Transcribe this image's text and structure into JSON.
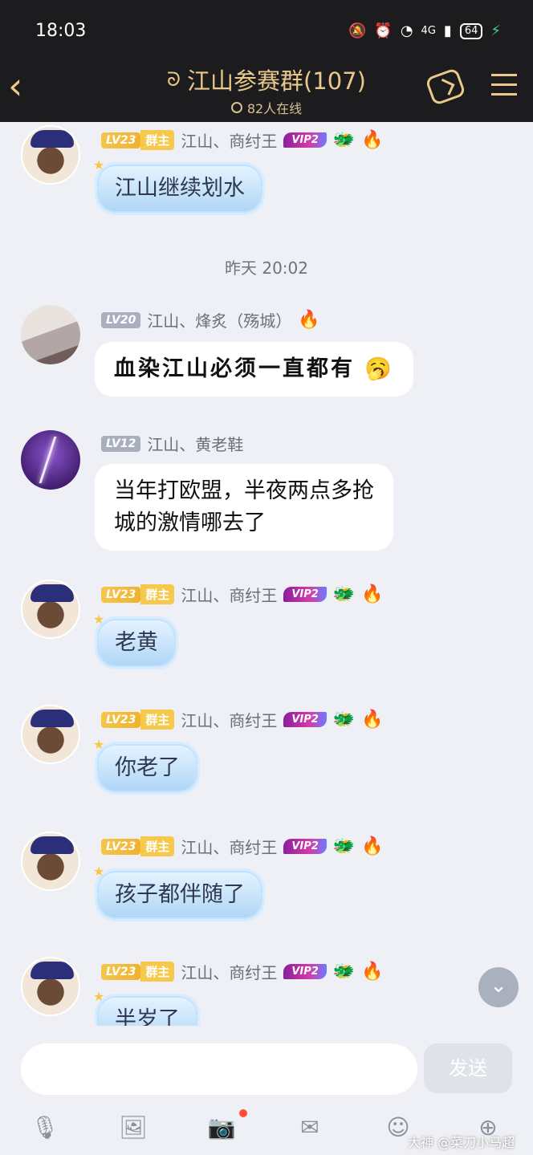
{
  "status_bar": {
    "time": "18:03",
    "network": "4G",
    "battery": "64"
  },
  "header": {
    "title": "江山参赛群(107)",
    "online": "82人在线",
    "icons": [
      "back-icon",
      "ear-icon",
      "share-link-icon",
      "menu-icon"
    ]
  },
  "messages": [
    {
      "level": "LV23",
      "role": "群主",
      "name": "江山、商纣王",
      "vip": "VIP2",
      "text": "江山继续划水"
    },
    {
      "timestamp": "昨天 20:02"
    },
    {
      "level": "LV20",
      "name": "江山、烽炙（殇城）",
      "text": "血染江山必须一直都有"
    },
    {
      "level": "LV12",
      "name": "江山、黄老鞋",
      "text_line1": "当年打欧盟，半夜两点多抢",
      "text_line2": "城的激情哪去了"
    },
    {
      "level": "LV23",
      "role": "群主",
      "name": "江山、商纣王",
      "vip": "VIP2",
      "text": "老黄"
    },
    {
      "level": "LV23",
      "role": "群主",
      "name": "江山、商纣王",
      "vip": "VIP2",
      "text": "你老了"
    },
    {
      "level": "LV23",
      "role": "群主",
      "name": "江山、商纣王",
      "vip": "VIP2",
      "text": "孩子都伴随了"
    },
    {
      "level": "LV23",
      "role": "群主",
      "name": "江山、商纣王",
      "vip": "VIP2",
      "text": "半岁了"
    }
  ],
  "input": {
    "placeholder": "",
    "send_label": "发送"
  },
  "toolbar": {
    "icons": [
      "mic-icon",
      "image-icon",
      "camera-icon",
      "red-packet-icon",
      "emoji-icon",
      "plus-icon"
    ]
  },
  "watermark": "大神 @菜刀小马超"
}
